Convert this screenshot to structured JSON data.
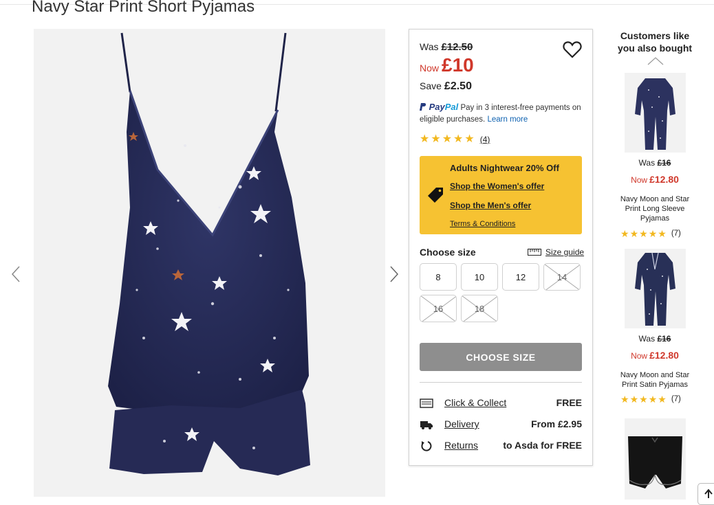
{
  "product": {
    "title": "Navy Star Print Short Pyjamas"
  },
  "price": {
    "was_label": "Was",
    "was_value": "£12.50",
    "now_label": "Now",
    "now_value": "£10",
    "save_label": "Save",
    "save_value": "£2.50"
  },
  "paypal": {
    "logo_a": "Pay",
    "logo_b": "Pal",
    "text": "Pay in 3 interest-free payments on eligible purchases.",
    "link": "Learn more"
  },
  "rating": {
    "stars": 5,
    "count": "(4)"
  },
  "offer": {
    "title": "Adults Nightwear 20% Off",
    "womens_link": "Shop the Women's offer",
    "mens_link": "Shop the Men's offer",
    "terms": "Terms & Conditions",
    "bg_color": "#f6c232"
  },
  "sizes": {
    "label": "Choose size",
    "guide": "Size guide",
    "options": [
      {
        "label": "8",
        "available": true
      },
      {
        "label": "10",
        "available": true
      },
      {
        "label": "12",
        "available": true
      },
      {
        "label": "14",
        "available": false
      },
      {
        "label": "16",
        "available": false
      },
      {
        "label": "18",
        "available": false
      }
    ]
  },
  "choose_button": "CHOOSE SIZE",
  "delivery": [
    {
      "icon": "collect-icon",
      "label": "Click & Collect",
      "value": "FREE"
    },
    {
      "icon": "van-icon",
      "label": "Delivery",
      "value": "From £2.95"
    },
    {
      "icon": "returns-icon",
      "label": "Returns",
      "value": "to Asda for FREE"
    }
  ],
  "recommendations": {
    "title": "Customers like you also bought",
    "items": [
      {
        "was_label": "Was",
        "was": "£16",
        "now_label": "Now",
        "now": "£12.80",
        "name": "Navy Moon and Star Print Long Sleeve Pyjamas",
        "rating": 4.5,
        "count": "(7)"
      },
      {
        "was_label": "Was",
        "was": "£16",
        "now_label": "Now",
        "now": "£12.80",
        "name": "Navy Moon and Star Print Satin Pyjamas",
        "rating": 4.5,
        "count": "(7)"
      },
      {
        "name": ""
      }
    ]
  },
  "colors": {
    "accent_red": "#d0382b",
    "navy": "#262a55",
    "star": "#f2b81f"
  }
}
